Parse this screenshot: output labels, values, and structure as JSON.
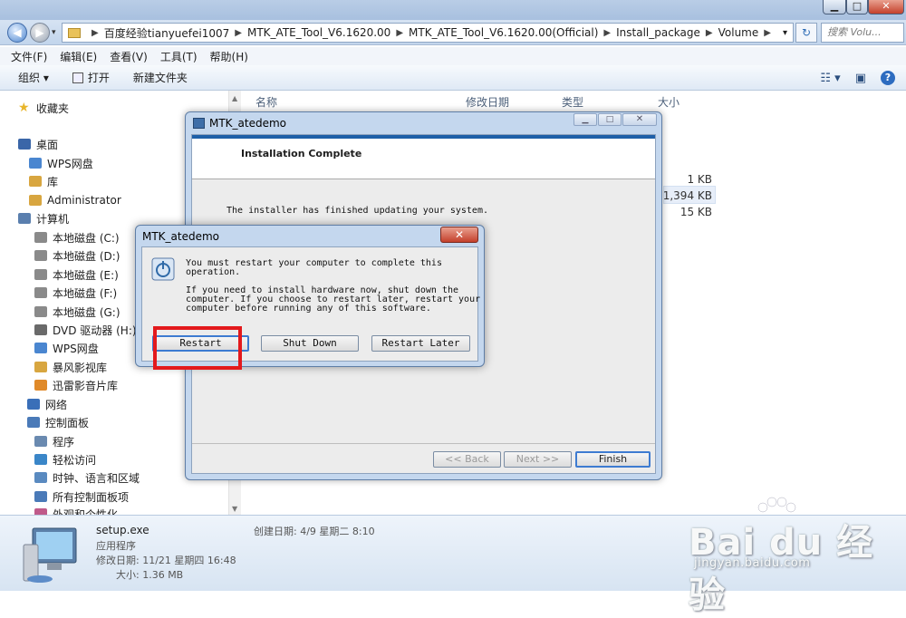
{
  "window": {
    "min_label": "▁",
    "max_label": "□",
    "close_label": "✕"
  },
  "address": {
    "crumbs": [
      "百度经验tianyuefei1007",
      "MTK_ATE_Tool_V6.1620.00",
      "MTK_ATE_Tool_V6.1620.00(Official)",
      "Install_package",
      "Volume"
    ],
    "search_placeholder": "搜索 Volu..."
  },
  "menu": [
    "文件(F)",
    "编辑(E)",
    "查看(V)",
    "工具(T)",
    "帮助(H)"
  ],
  "toolbar": {
    "organize": "组织 ▾",
    "open": "打开",
    "new_folder": "新建文件夹"
  },
  "sidebar": {
    "items": [
      {
        "label": "收藏夹",
        "icon": "star-icon",
        "color": "#e8b52a"
      },
      {
        "label": "桌面",
        "icon": "desktop-icon",
        "color": "#3a66a8"
      },
      {
        "label": "WPS网盘",
        "icon": "cloud-icon",
        "color": "#4a86d0"
      },
      {
        "label": "库",
        "icon": "library-icon",
        "color": "#d8a640"
      },
      {
        "label": "Administrator",
        "icon": "user-folder-icon",
        "color": "#d8a640"
      },
      {
        "label": "计算机",
        "icon": "computer-icon",
        "color": "#5a7fae"
      },
      {
        "label": "本地磁盘 (C:)",
        "icon": "drive-icon",
        "color": "#8a8a8a"
      },
      {
        "label": "本地磁盘 (D:)",
        "icon": "drive-icon",
        "color": "#8a8a8a"
      },
      {
        "label": "本地磁盘 (E:)",
        "icon": "drive-icon",
        "color": "#8a8a8a"
      },
      {
        "label": "本地磁盘 (F:)",
        "icon": "drive-icon",
        "color": "#8a8a8a"
      },
      {
        "label": "本地磁盘 (G:)",
        "icon": "drive-icon",
        "color": "#8a8a8a"
      },
      {
        "label": "DVD 驱动器 (H:)",
        "icon": "dvd-icon",
        "color": "#6a6a6a"
      },
      {
        "label": "WPS网盘",
        "icon": "cloud-icon",
        "color": "#4a86d0"
      },
      {
        "label": "暴风影视库",
        "icon": "media-library-icon",
        "color": "#d8a640"
      },
      {
        "label": "迅雷影音片库",
        "icon": "media-library-icon",
        "color": "#e08a2a"
      },
      {
        "label": "网络",
        "icon": "network-icon",
        "color": "#3a6fb8"
      },
      {
        "label": "控制面板",
        "icon": "control-panel-icon",
        "color": "#4a7ab8"
      },
      {
        "label": "程序",
        "icon": "programs-icon",
        "color": "#6a8ab0"
      },
      {
        "label": "轻松访问",
        "icon": "ease-access-icon",
        "color": "#3a86c8"
      },
      {
        "label": "时钟、语言和区域",
        "icon": "clock-icon",
        "color": "#5a8ac0"
      },
      {
        "label": "所有控制面板项",
        "icon": "control-panel-icon",
        "color": "#4a7ab8"
      },
      {
        "label": "外观和个性化",
        "icon": "appearance-icon",
        "color": "#c05a8a"
      }
    ]
  },
  "list": {
    "headers": [
      "名称",
      "修改日期",
      "类型",
      "大小"
    ],
    "sizes": [
      "1 KB",
      "1,394 KB",
      "15 KB"
    ]
  },
  "details": {
    "filename": "setup.exe",
    "type": "应用程序",
    "modified": "修改日期: 11/21 星期四 16:48",
    "size": "大小: 1.36 MB",
    "created": "创建日期: 4/9 星期二 8:10"
  },
  "dialog1": {
    "title": "MTK_atedemo",
    "heading": "Installation Complete",
    "message": "The installer has finished updating your system.",
    "back": "<< Back",
    "next": "Next >>",
    "finish": "Finish"
  },
  "dialog2": {
    "title": "MTK_atedemo",
    "line1": "You must restart your computer to complete this",
    "line2": "operation.",
    "line3": "If you need to install hardware now, shut down the",
    "line4": "computer. If you choose to restart later, restart your",
    "line5": "computer before running any of this software.",
    "restart": "Restart",
    "shutdown": "Shut Down",
    "restart_later": "Restart Later"
  },
  "watermark": {
    "logo": "Bai du 经验",
    "url": "jingyan.baidu.com"
  }
}
